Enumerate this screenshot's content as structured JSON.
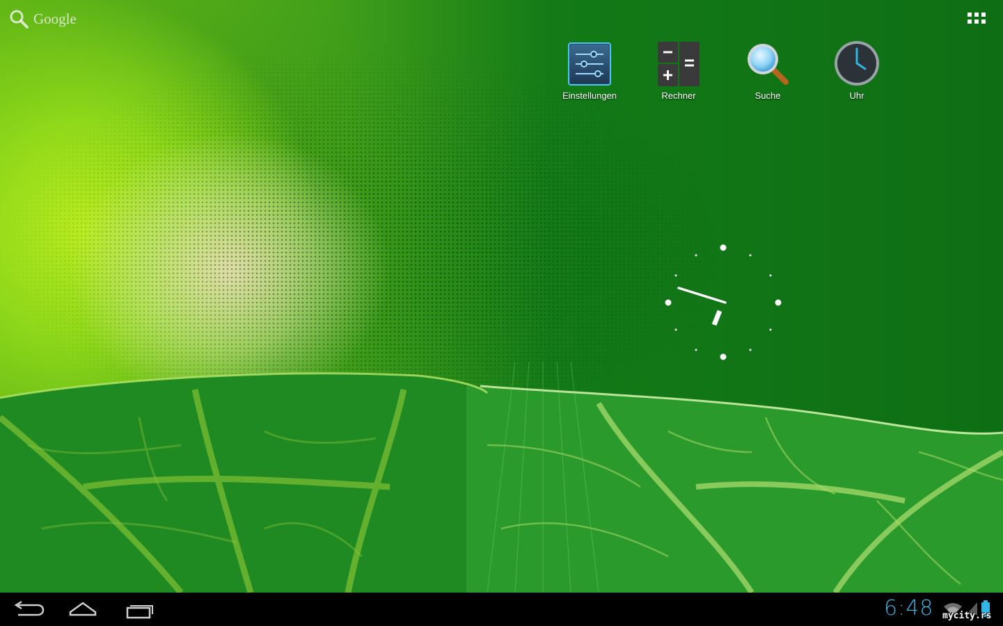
{
  "search_bar": {
    "label": "Google",
    "icon": "search-icon"
  },
  "apps_button": {
    "icon": "all-apps-icon"
  },
  "shortcuts": [
    {
      "label": "Einstellungen",
      "icon": "settings-icon"
    },
    {
      "label": "Rechner",
      "icon": "calculator-icon"
    },
    {
      "label": "Suche",
      "icon": "search-magnifier-icon"
    },
    {
      "label": "Uhr",
      "icon": "clock-icon"
    }
  ],
  "analog_clock_widget": {
    "time": "6:48"
  },
  "navigation_bar": {
    "back": "back-icon",
    "home": "home-icon",
    "recents": "recent-apps-icon"
  },
  "status": {
    "time": "6:48",
    "wifi": "wifi-icon",
    "signal": "signal-icon",
    "battery": "battery-icon"
  },
  "watermark": "mycity.rs",
  "colors": {
    "accent": "#33b5e5",
    "navbar": "#000000",
    "wallpaper": "#0e6e14"
  }
}
